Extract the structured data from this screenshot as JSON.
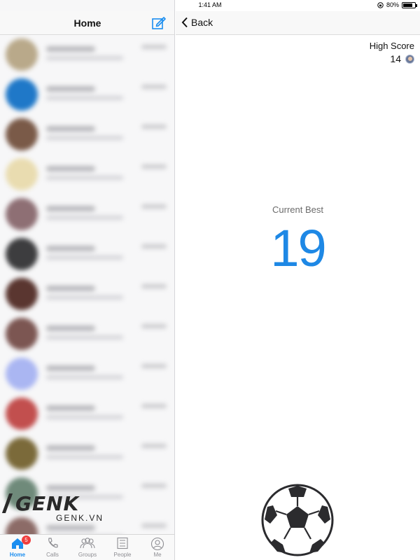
{
  "status_bar": {
    "device": "iPad",
    "time": "1:41 AM",
    "battery": "80%",
    "battery_level": 0.8
  },
  "left_pane": {
    "title": "Home",
    "compose_icon": "compose-icon",
    "conversation_avatar_colors": [
      "#b9a98a",
      "#1f78c8",
      "#7a5a48",
      "#e9dcb0",
      "#8e6f74",
      "#3d3d3f",
      "#5a3630",
      "#7c5652",
      "#aab6f2",
      "#c24f4e",
      "#7b6a3a",
      "#6f8a7a",
      "#8c6b67"
    ]
  },
  "tab_bar": {
    "tabs": [
      {
        "label": "Home",
        "icon": "home-icon",
        "badge": "5",
        "active": true
      },
      {
        "label": "Calls",
        "icon": "phone-icon",
        "active": false
      },
      {
        "label": "Groups",
        "icon": "groups-icon",
        "active": false
      },
      {
        "label": "People",
        "icon": "people-list-icon",
        "active": false
      },
      {
        "label": "Me",
        "icon": "profile-icon",
        "active": false
      }
    ]
  },
  "right_pane": {
    "back_label": "Back",
    "high_score_label": "High Score",
    "high_score_value": "14",
    "current_best_label": "Current Best",
    "current_best_value": "19"
  },
  "watermark": {
    "logo_text": "GENK",
    "site": "GENK.VN"
  },
  "colors": {
    "accent": "#1e88e5",
    "badge": "#f03e3e"
  }
}
